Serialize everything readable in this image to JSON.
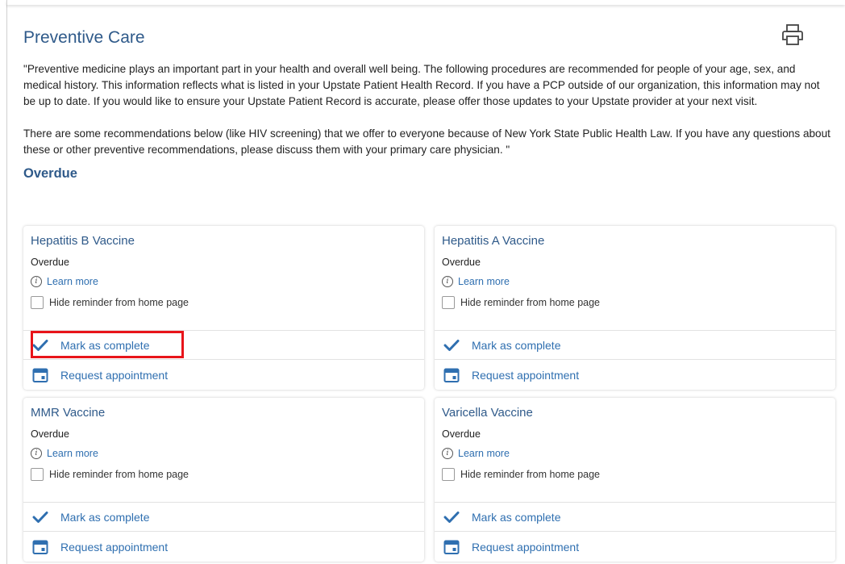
{
  "page": {
    "title": "Preventive Care",
    "intro_paragraphs": [
      "\"Preventive medicine plays an important part in your health and overall well being. The following procedures are recommended for people of your age, sex, and medical history. This information reflects what is listed in your Upstate Patient Health Record. If you have a PCP outside of our organization, this information may not be up to date. If you would like to ensure your Upstate Patient Record is accurate, please offer those updates to your Upstate provider at your next visit.",
      "There are some recommendations below (like HIV screening) that we offer to everyone because of New York State Public Health Law. If you have any questions about these or other preventive recommendations, please discuss them with your primary care physician. \""
    ],
    "section_title": "Overdue"
  },
  "colors": {
    "accent": "#2f5a8a",
    "link": "#2f6fb0",
    "highlight": "#e8141a"
  },
  "icons": {
    "print": "printer-icon",
    "info": "info-icon",
    "check": "checkmark-icon",
    "calendar": "calendar-icon"
  },
  "cards": [
    {
      "name": "Hepatitis B Vaccine",
      "status": "Overdue",
      "learn_more": "Learn more",
      "hide_label": "Hide reminder from home page",
      "mark_complete": "Mark as complete",
      "request_appt": "Request appointment",
      "highlighted": true
    },
    {
      "name": "Hepatitis A Vaccine",
      "status": "Overdue",
      "learn_more": "Learn more",
      "hide_label": "Hide reminder from home page",
      "mark_complete": "Mark as complete",
      "request_appt": "Request appointment",
      "highlighted": false
    },
    {
      "name": "MMR Vaccine",
      "status": "Overdue",
      "learn_more": "Learn more",
      "hide_label": "Hide reminder from home page",
      "mark_complete": "Mark as complete",
      "request_appt": "Request appointment",
      "highlighted": false
    },
    {
      "name": "Varicella Vaccine",
      "status": "Overdue",
      "learn_more": "Learn more",
      "hide_label": "Hide reminder from home page",
      "mark_complete": "Mark as complete",
      "request_appt": "Request appointment",
      "highlighted": false
    }
  ]
}
